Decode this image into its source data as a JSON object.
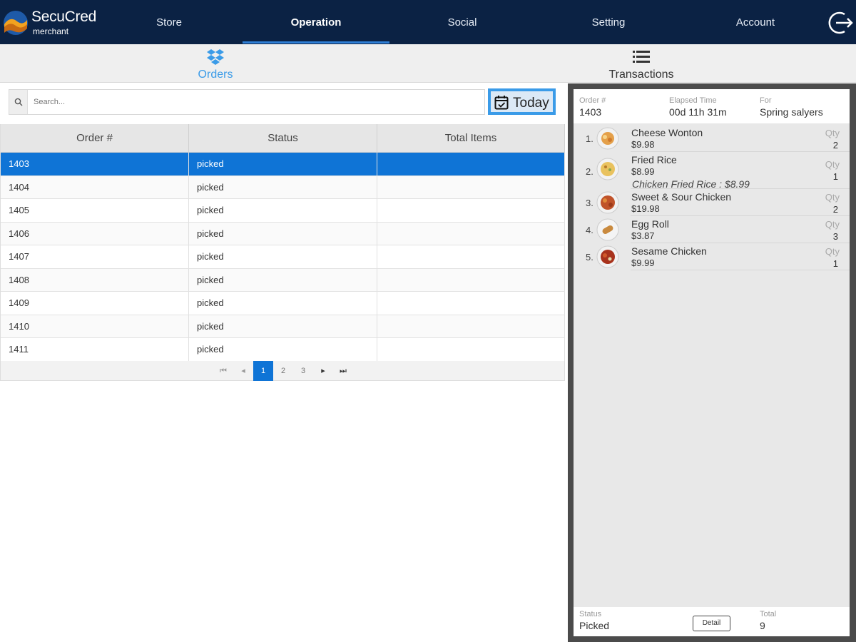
{
  "brand": {
    "name": "SecuCred",
    "sub": "merchant"
  },
  "nav": {
    "items": [
      "Store",
      "Operation",
      "Social",
      "Setting",
      "Account"
    ],
    "active": "Operation"
  },
  "subtabs": {
    "orders": "Orders",
    "transactions": "Transactions"
  },
  "search": {
    "placeholder": "Search..."
  },
  "today_label": "Today",
  "table": {
    "headers": [
      "Order #",
      "Status",
      "Total Items"
    ],
    "rows": [
      [
        "1403",
        "picked",
        ""
      ],
      [
        "1404",
        "picked",
        ""
      ],
      [
        "1405",
        "picked",
        ""
      ],
      [
        "1406",
        "picked",
        ""
      ],
      [
        "1407",
        "picked",
        ""
      ],
      [
        "1408",
        "picked",
        ""
      ],
      [
        "1409",
        "picked",
        ""
      ],
      [
        "1410",
        "picked",
        ""
      ],
      [
        "1411",
        "picked",
        ""
      ]
    ],
    "selected_row": 0
  },
  "pager": {
    "pages": [
      "1",
      "2",
      "3"
    ],
    "active": "1"
  },
  "order": {
    "number_label": "Order #",
    "number": "1403",
    "elapsed_label": "Elapsed Time",
    "elapsed": "00d 11h 31m",
    "for_label": "For",
    "for": "Spring salyers",
    "qty_label": "Qty",
    "items": [
      {
        "num": "1.",
        "name": "Cheese Wonton",
        "price": "$9.98",
        "note": "",
        "qty": "2"
      },
      {
        "num": "2.",
        "name": "Fried Rice",
        "price": "$8.99",
        "note": "Chicken Fried Rice : $8.99",
        "qty": "1"
      },
      {
        "num": "3.",
        "name": "Sweet & Sour Chicken",
        "price": "$19.98",
        "note": "",
        "qty": "2"
      },
      {
        "num": "4.",
        "name": "Egg Roll",
        "price": "$3.87",
        "note": "",
        "qty": "3"
      },
      {
        "num": "5.",
        "name": "Sesame Chicken",
        "price": "$9.99",
        "note": "",
        "qty": "1"
      }
    ],
    "status_label": "Status",
    "status": "Picked",
    "detail_label": "Detail",
    "total_label": "Total",
    "total": "9"
  },
  "colors": {
    "nav_bg": "#0b2244",
    "accent": "#0f74d6",
    "tab_active": "#3a9be8"
  },
  "icons": {
    "logo": "secucred-logo",
    "logout": "logout-icon",
    "orders": "dropbox-icon",
    "transactions": "list-icon",
    "search": "search-icon",
    "today": "calendar-check-icon"
  }
}
